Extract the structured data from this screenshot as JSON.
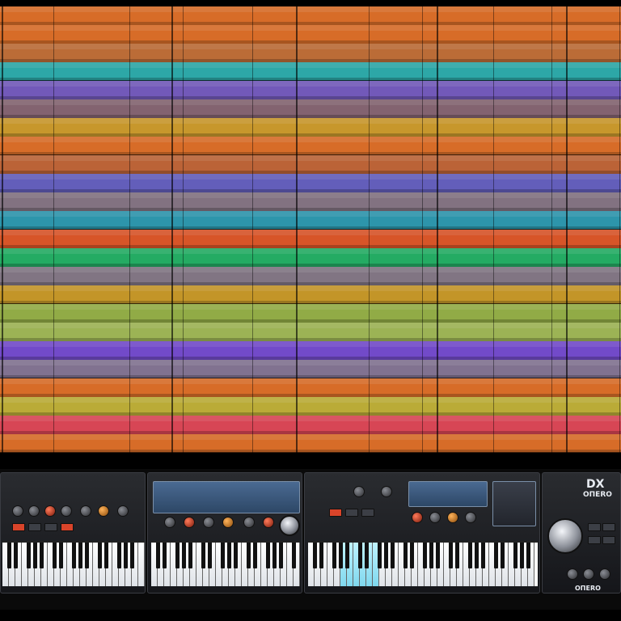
{
  "window": {
    "title": ""
  },
  "arrangement": {
    "lane_colors": [
      "#e8742a",
      "#e8742a",
      "#c9733a",
      "#2fb3b3",
      "#7a5fc7",
      "#8c6a78",
      "#d6a22e",
      "#e8742a",
      "#c96a3a",
      "#6a64c8",
      "#8b7a8a",
      "#2fa0b8",
      "#e85a2a",
      "#25b86a",
      "#8a7d8c",
      "#d2a02a",
      "#9cb84a",
      "#a8c05a",
      "#7a4fd8",
      "#8a7a9a",
      "#e8742a",
      "#c8b83a",
      "#e84a5a",
      "#e8742a"
    ]
  },
  "rack": {
    "unit1": {
      "label": ""
    },
    "unit2": {
      "display": ""
    },
    "unit3": {
      "display": ""
    },
    "unit4": {
      "brand": "DX",
      "model": "ОПЕRO",
      "footer": "OПERO"
    }
  }
}
